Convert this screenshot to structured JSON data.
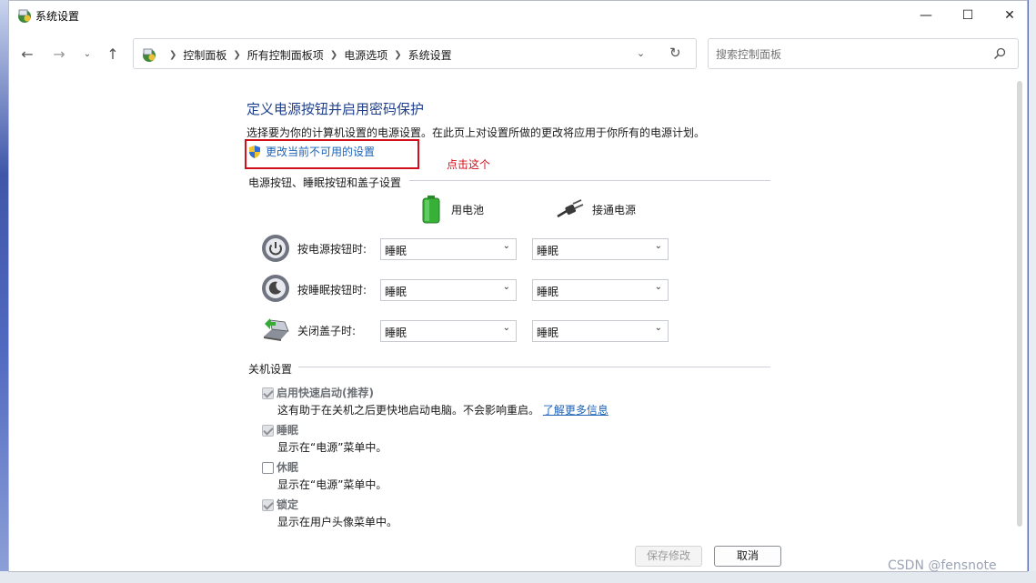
{
  "window": {
    "title": "系统设置",
    "controls": {
      "minimize": "—",
      "maximize": "☐",
      "close": "✕"
    }
  },
  "nav": {
    "back": "←",
    "forward": "→",
    "recent": "⌄",
    "up": "↑",
    "breadcrumbs": [
      "控制面板",
      "所有控制面板项",
      "电源选项",
      "系统设置"
    ],
    "search_placeholder": "搜索控制面板"
  },
  "page": {
    "heading": "定义电源按钮并启用密码保护",
    "description": "选择要为你的计算机设置的电源设置。在此页上对设置所做的更改将应用于你所有的电源计划。",
    "change_link": "更改当前不可用的设置",
    "annotation": "点击这个"
  },
  "power_section": {
    "title": "电源按钮、睡眠按钮和盖子设置",
    "col_battery": "用电池",
    "col_plugged": "接通电源",
    "rows": [
      {
        "label": "按电源按钮时:",
        "battery": "睡眠",
        "plugged": "睡眠",
        "icon": "power-button-icon"
      },
      {
        "label": "按睡眠按钮时:",
        "battery": "睡眠",
        "plugged": "睡眠",
        "icon": "sleep-button-icon"
      },
      {
        "label": "关闭盖子时:",
        "battery": "睡眠",
        "plugged": "睡眠",
        "icon": "laptop-lid-icon"
      }
    ]
  },
  "shutdown_section": {
    "title": "关机设置",
    "options": [
      {
        "label": "启用快速启动(推荐)",
        "desc": "这有助于在关机之后更快地启动电脑。不会影响重启。",
        "link": "了解更多信息",
        "checked": true
      },
      {
        "label": "睡眠",
        "desc": "显示在“电源”菜单中。",
        "checked": true
      },
      {
        "label": "休眠",
        "desc": "显示在“电源”菜单中。",
        "checked": false
      },
      {
        "label": "锁定",
        "desc": "显示在用户头像菜单中。",
        "checked": true
      }
    ]
  },
  "footer": {
    "save": "保存修改",
    "cancel": "取消"
  },
  "watermark": "CSDN @fensnote",
  "colors": {
    "heading": "#1e3f8c",
    "link": "#1e63b8",
    "annotation_red": "#d0101a"
  }
}
